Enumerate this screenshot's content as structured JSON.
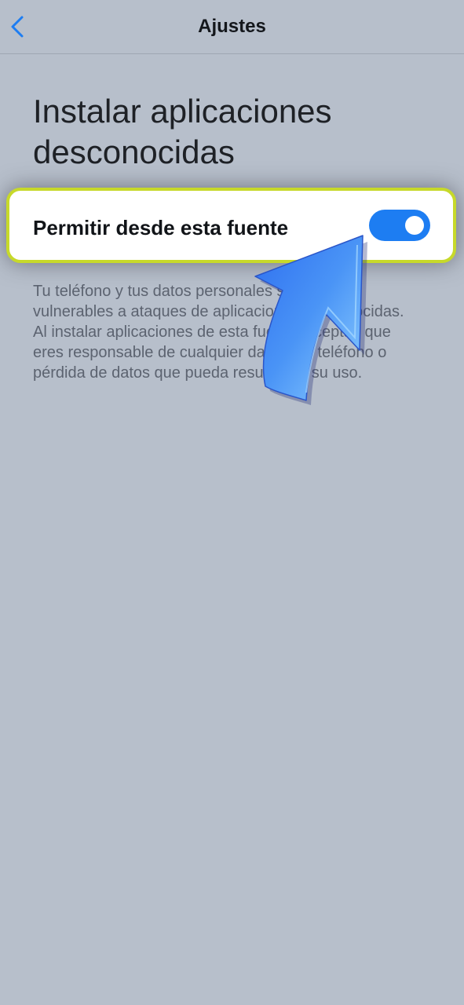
{
  "header": {
    "title": "Ajustes",
    "back_icon": "chevron-left-icon"
  },
  "page": {
    "title": "Instalar aplicaciones desconocidas"
  },
  "setting": {
    "label": "Permitir desde esta fuente",
    "toggle_on": true
  },
  "description": "Tu teléfono y tus datos personales son más vulnerables a ataques de aplicaciones desconocidas. Al instalar aplicaciones de esta fuente, aceptas que eres responsable de cualquier daño a tu teléfono o pérdida de datos que pueda resultar de su uso.",
  "colors": {
    "background": "#b7bfcb",
    "accent": "#1d7df2",
    "highlight": "#c7d92a",
    "arrow": "#3a86f2"
  }
}
